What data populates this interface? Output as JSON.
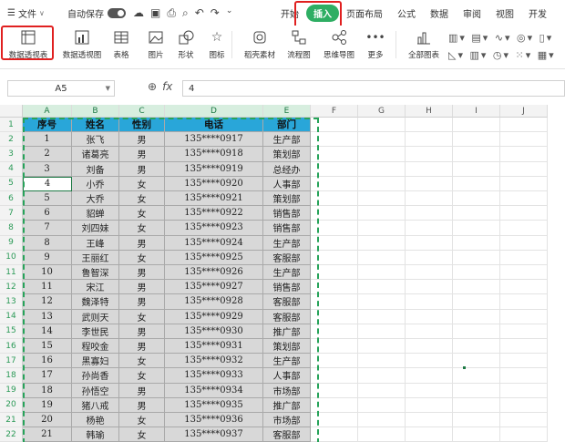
{
  "menu": {
    "file_label": "文件",
    "autosave_label": "自动保存",
    "tabs": [
      "开始",
      "插入",
      "页面布局",
      "公式",
      "数据",
      "审阅",
      "视图",
      "开发"
    ],
    "active_tab": "插入"
  },
  "ribbon": {
    "items": [
      "数据透视表",
      "数据透视图",
      "表格",
      "图片",
      "形状",
      "图标",
      "稻壳素材",
      "流程图",
      "思维导图",
      "更多",
      "全部图表"
    ]
  },
  "formula_bar": {
    "name_box": "A5",
    "fx_label": "fx",
    "value": "4"
  },
  "sheet": {
    "columns": [
      "A",
      "B",
      "C",
      "D",
      "E",
      "F",
      "G",
      "H",
      "I",
      "J"
    ],
    "headers": [
      "序号",
      "姓名",
      "性别",
      "电话",
      "部门"
    ],
    "rows": [
      [
        "1",
        "张飞",
        "男",
        "135****0917",
        "生产部"
      ],
      [
        "2",
        "诸葛亮",
        "男",
        "135****0918",
        "策划部"
      ],
      [
        "3",
        "刘备",
        "男",
        "135****0919",
        "总经办"
      ],
      [
        "4",
        "小乔",
        "女",
        "135****0920",
        "人事部"
      ],
      [
        "5",
        "大乔",
        "女",
        "135****0921",
        "策划部"
      ],
      [
        "6",
        "貂蝉",
        "女",
        "135****0922",
        "销售部"
      ],
      [
        "7",
        "刘四妹",
        "女",
        "135****0923",
        "销售部"
      ],
      [
        "8",
        "王峰",
        "男",
        "135****0924",
        "生产部"
      ],
      [
        "9",
        "王丽红",
        "女",
        "135****0925",
        "客服部"
      ],
      [
        "10",
        "鲁智深",
        "男",
        "135****0926",
        "生产部"
      ],
      [
        "11",
        "宋江",
        "男",
        "135****0927",
        "销售部"
      ],
      [
        "12",
        "魏泽特",
        "男",
        "135****0928",
        "客服部"
      ],
      [
        "13",
        "武则天",
        "女",
        "135****0929",
        "客服部"
      ],
      [
        "14",
        "李世民",
        "男",
        "135****0930",
        "推广部"
      ],
      [
        "15",
        "程咬金",
        "男",
        "135****0931",
        "策划部"
      ],
      [
        "16",
        "黑寡妇",
        "女",
        "135****0932",
        "生产部"
      ],
      [
        "17",
        "孙尚香",
        "女",
        "135****0933",
        "人事部"
      ],
      [
        "18",
        "孙悟空",
        "男",
        "135****0934",
        "市场部"
      ],
      [
        "19",
        "猪八戒",
        "男",
        "135****0935",
        "推广部"
      ],
      [
        "20",
        "杨艳",
        "女",
        "135****0936",
        "市场部"
      ],
      [
        "21",
        "韩瑜",
        "女",
        "135****0937",
        "客服部"
      ]
    ],
    "row_numbers": [
      "1",
      "2",
      "3",
      "4",
      "5",
      "6",
      "7",
      "8",
      "9",
      "10",
      "11",
      "12",
      "13",
      "14",
      "15",
      "16",
      "17",
      "18",
      "19",
      "20",
      "21",
      "22"
    ]
  },
  "colors": {
    "accent": "#2eae63",
    "header_fill": "#29a6d9",
    "data_fill": "#d8d8d8",
    "highlight_red": "#e02020"
  }
}
